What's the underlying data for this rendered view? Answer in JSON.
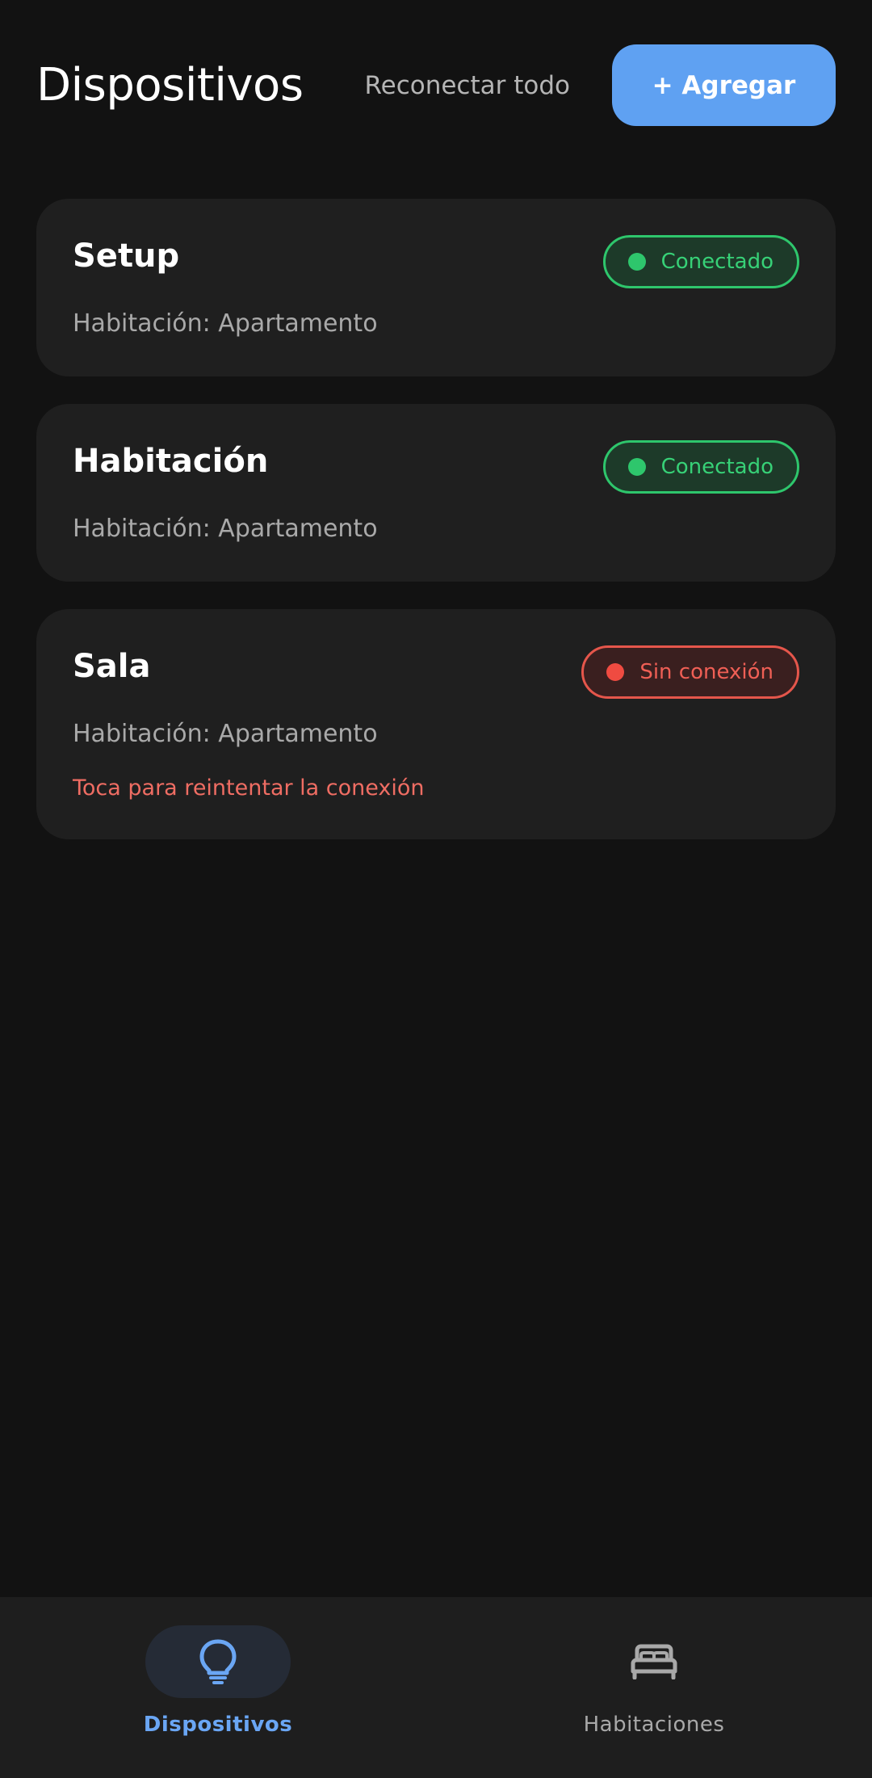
{
  "header": {
    "title": "Dispositivos",
    "reconnect_label": "Reconectar todo",
    "add_label": "+ Agregar"
  },
  "devices": [
    {
      "name": "Setup",
      "room": "Habitación: Apartamento",
      "status": "Conectado"
    },
    {
      "name": "Habitación",
      "room": "Habitación: Apartamento",
      "status": "Conectado"
    },
    {
      "name": "Sala",
      "room": "Habitación: Apartamento",
      "status": "Sin conexión",
      "retry_text": "Toca para reintentar la conexión"
    }
  ],
  "bottom_nav": {
    "items": [
      {
        "label": "Dispositivos",
        "icon": "lightbulb-icon",
        "active": true
      },
      {
        "label": "Habitaciones",
        "icon": "bed-icon",
        "active": false
      }
    ]
  },
  "colors": {
    "accent": "#5fa1f2",
    "connected": "#2ec66c",
    "disconnected": "#e5564b",
    "background": "#121212",
    "card": "#1f1f1f"
  }
}
